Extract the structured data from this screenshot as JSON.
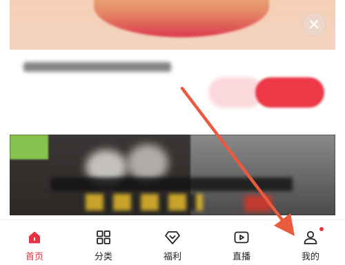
{
  "colors": {
    "accent": "#e7323f",
    "annotation_arrow": "#ea5a3f",
    "tab_label": "#222222"
  },
  "tabbar": {
    "tabs": [
      {
        "label": "首页",
        "icon": "home-icon",
        "active": true
      },
      {
        "label": "分类",
        "icon": "grid-icon",
        "active": false
      },
      {
        "label": "福利",
        "icon": "diamond-icon",
        "active": false
      },
      {
        "label": "直播",
        "icon": "play-icon",
        "active": false
      },
      {
        "label": "我的",
        "icon": "user-icon",
        "active": false,
        "has_notification_dot": true
      }
    ]
  }
}
